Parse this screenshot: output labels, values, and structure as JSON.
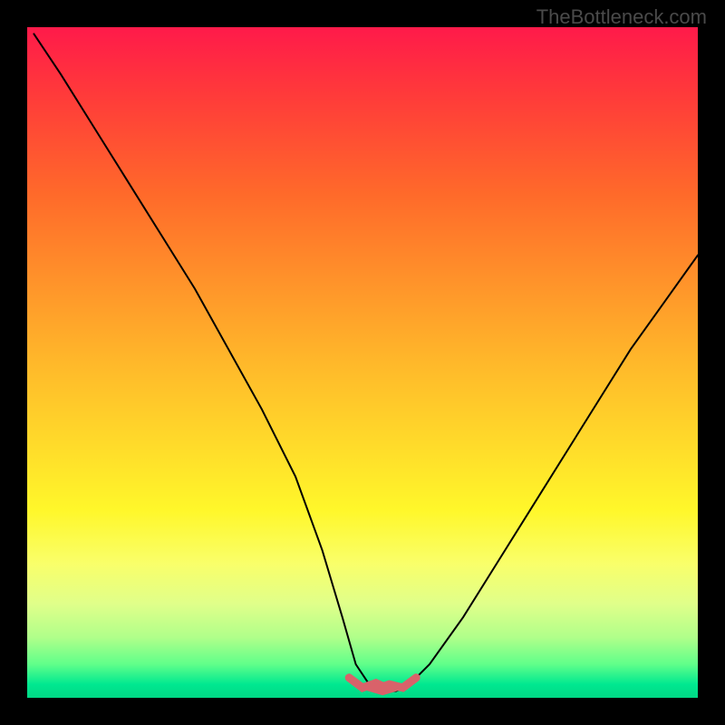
{
  "watermark": "TheBottleneck.com",
  "chart_data": {
    "type": "line",
    "title": "",
    "xlabel": "",
    "ylabel": "",
    "xlim": [
      0,
      100
    ],
    "ylim": [
      0,
      100
    ],
    "series": [
      {
        "name": "curve",
        "x": [
          1,
          5,
          10,
          15,
          20,
          25,
          30,
          35,
          40,
          44,
          47,
          49,
          51,
          53,
          55,
          57,
          60,
          65,
          70,
          75,
          80,
          85,
          90,
          95,
          100
        ],
        "y": [
          99,
          93,
          85,
          77,
          69,
          61,
          52,
          43,
          33,
          22,
          12,
          5,
          2,
          1,
          1,
          2,
          5,
          12,
          20,
          28,
          36,
          44,
          52,
          59,
          66
        ]
      }
    ],
    "annotations": [
      {
        "type": "flat_valley",
        "x_range": [
          49,
          57
        ],
        "y": 1
      }
    ],
    "background_gradient": [
      "#ff1a4a",
      "#ffda2a",
      "#00d885"
    ]
  }
}
